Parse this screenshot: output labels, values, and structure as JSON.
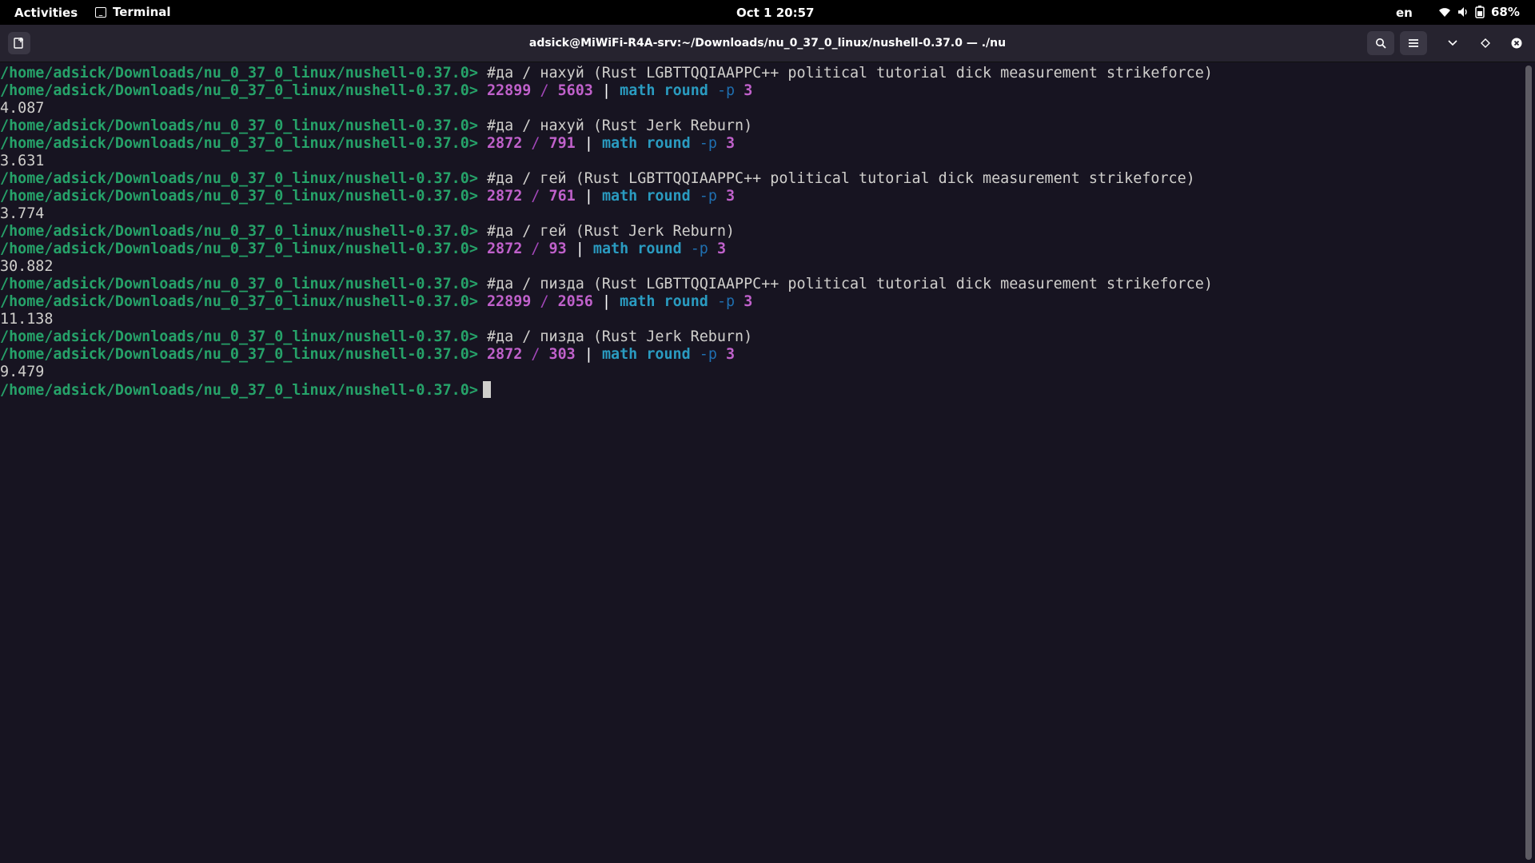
{
  "topbar": {
    "activities": "Activities",
    "app_name": "Terminal",
    "clock": "Oct 1  20:57",
    "language": "en",
    "battery": "68%"
  },
  "window": {
    "title": "adsick@MiWiFi-R4A-srv:~/Downloads/nu_0_37_0_linux/nushell-0.37.0 — ./nu"
  },
  "icons": {
    "new_tab": "new-tab-icon",
    "search": "search-icon",
    "menu": "hamburger-menu-icon",
    "dropdown": "chevron-down-icon",
    "tag": "diamond-icon",
    "close": "close-icon"
  },
  "colors": {
    "prompt": "#26a269",
    "number": "#c061cb",
    "command": "#2a9bc0",
    "flag": "#1f6fb0",
    "background": "#171421"
  },
  "terminal": {
    "prompt": "/home/adsick/Downloads/nu_0_37_0_linux/nushell-0.37.0>",
    "pipe": "|",
    "slash": "/",
    "math": "math",
    "round": "round",
    "flag": "-p",
    "blocks": [
      {
        "comment": "#да / нахуй (Rust LGBTTQQIAAPPC++ political tutorial dick measurement strikeforce)",
        "a": "22899",
        "b": "5603",
        "p": "3",
        "result": "4.087"
      },
      {
        "comment": "#да / нахуй (Rust Jerk Reburn)",
        "a": "2872",
        "b": "791",
        "p": "3",
        "result": "3.631"
      },
      {
        "comment": "#да / гей (Rust LGBTTQQIAAPPC++ political tutorial dick measurement strikeforce)",
        "a": "2872",
        "b": "761",
        "p": "3",
        "result": "3.774"
      },
      {
        "comment": "#да / гей (Rust Jerk Reburn)",
        "a": "2872",
        "b": "93",
        "p": "3",
        "result": "30.882"
      },
      {
        "comment": "#да / пизда (Rust LGBTTQQIAAPPC++ political tutorial dick measurement strikeforce)",
        "a": "22899",
        "b": "2056",
        "p": "3",
        "result": "11.138"
      },
      {
        "comment": "#да / пизда (Rust Jerk Reburn)",
        "a": "2872",
        "b": "303",
        "p": "3",
        "result": "9.479"
      }
    ]
  }
}
